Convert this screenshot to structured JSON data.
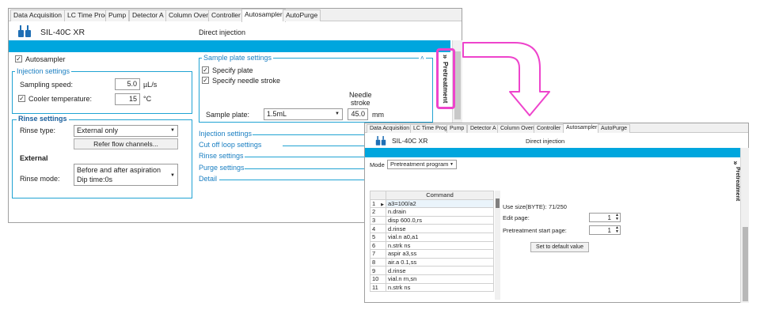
{
  "left_window": {
    "tabs": [
      "Data Acquisition",
      "LC Time Prog.",
      "Pump",
      "Detector A",
      "Column Oven",
      "Controller",
      "Autosampler",
      "AutoPurge"
    ],
    "active_tab": "Autosampler",
    "device_name": "SIL-40C XR",
    "mode": "Direct injection",
    "autosampler_label": "Autosampler",
    "injection_settings": {
      "title": "Injection settings",
      "sampling_speed_label": "Sampling speed:",
      "sampling_speed_value": "5.0",
      "sampling_speed_unit": "µL/s",
      "cooler_label": "Cooler temperature:",
      "cooler_value": "15",
      "cooler_unit": "°C"
    },
    "rinse_settings": {
      "title": "Rinse settings",
      "rinse_type_label": "Rinse type:",
      "rinse_type_value": "External only",
      "refer_button": "Refer flow channels...",
      "external_label": "External",
      "rinse_mode_label": "Rinse mode:",
      "rinse_mode_line1": "Before and after aspiration",
      "rinse_mode_line2": "Dip time:0s"
    },
    "sample_plate_settings": {
      "title": "Sample plate settings",
      "collapse_glyph": "˄",
      "specify_plate_label": "Specify plate",
      "specify_needle_label": "Specify needle stroke",
      "needle_stroke_label_1": "Needle",
      "needle_stroke_label_2": "stroke",
      "sample_plate_label": "Sample plate:",
      "sample_plate_value": "1.5mL",
      "needle_stroke_value": "45.0",
      "needle_stroke_unit": "mm"
    },
    "sections": [
      "Injection settings",
      "Cut off loop settings",
      "Rinse settings",
      "Purge settings",
      "Detail"
    ],
    "side_tab": "Pretreatment",
    "side_tab_glyph": "»"
  },
  "right_window": {
    "tabs": [
      "Data Acquisition",
      "LC Time Prog.",
      "Pump",
      "Detector A",
      "Column Oven",
      "Controller",
      "Autosampler",
      "AutoPurge"
    ],
    "active_tab": "Autosampler",
    "device_name": "SIL-40C XR",
    "mode_header": "Direct injection",
    "mode_label": "Mode",
    "mode_value": "Pretreatment program",
    "command_header": "Command",
    "rows": [
      {
        "num": "1",
        "cmd": "a3=100/a2"
      },
      {
        "num": "2",
        "cmd": "n.drain"
      },
      {
        "num": "3",
        "cmd": "disp 600.0,rs"
      },
      {
        "num": "4",
        "cmd": "d.rinse"
      },
      {
        "num": "5",
        "cmd": "vial.n a0,a1"
      },
      {
        "num": "6",
        "cmd": "n.strk ns"
      },
      {
        "num": "7",
        "cmd": "aspir a3,ss"
      },
      {
        "num": "8",
        "cmd": "air.a 0.1,ss"
      },
      {
        "num": "9",
        "cmd": "d.rinse"
      },
      {
        "num": "10",
        "cmd": "vial.n rn,sn"
      },
      {
        "num": "11",
        "cmd": "n.strk ns"
      }
    ],
    "use_size_label": "Use size(BYTE):",
    "use_size_value": "71/250",
    "edit_page_label": "Edit page:",
    "edit_page_value": "1",
    "start_page_label": "Pretreatment start page:",
    "start_page_value": "1",
    "default_button": "Set to default value",
    "side_tab": "Pretreatment",
    "side_tab_glyph": "»"
  },
  "colors": {
    "accent_blue": "#00a6de",
    "highlight_pink": "#ee44cc"
  },
  "icons": {
    "device": "autosampler-icon",
    "row_pointer": "row-pointer-icon",
    "check": "✓",
    "dropdown": "▼",
    "spin": "▲▼"
  }
}
